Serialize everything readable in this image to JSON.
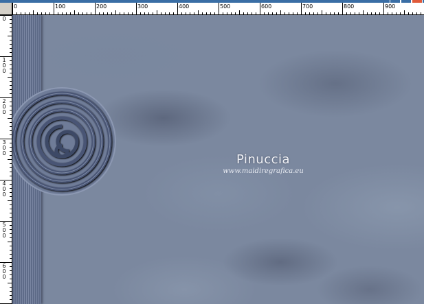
{
  "ruler": {
    "top_labels": [
      "0",
      "100",
      "200",
      "300",
      "400",
      "500",
      "600",
      "700",
      "800",
      "900"
    ],
    "left_labels": [
      "0",
      "100",
      "200",
      "300",
      "400",
      "500",
      "600"
    ]
  },
  "watermark": {
    "title": "Pinuccia",
    "url": "www.maidiregrafica.eu"
  },
  "colors": {
    "canvas_base": "#7b889f",
    "stripe_dark": "#5e6b88",
    "watermark_text": "#eef0f5"
  }
}
